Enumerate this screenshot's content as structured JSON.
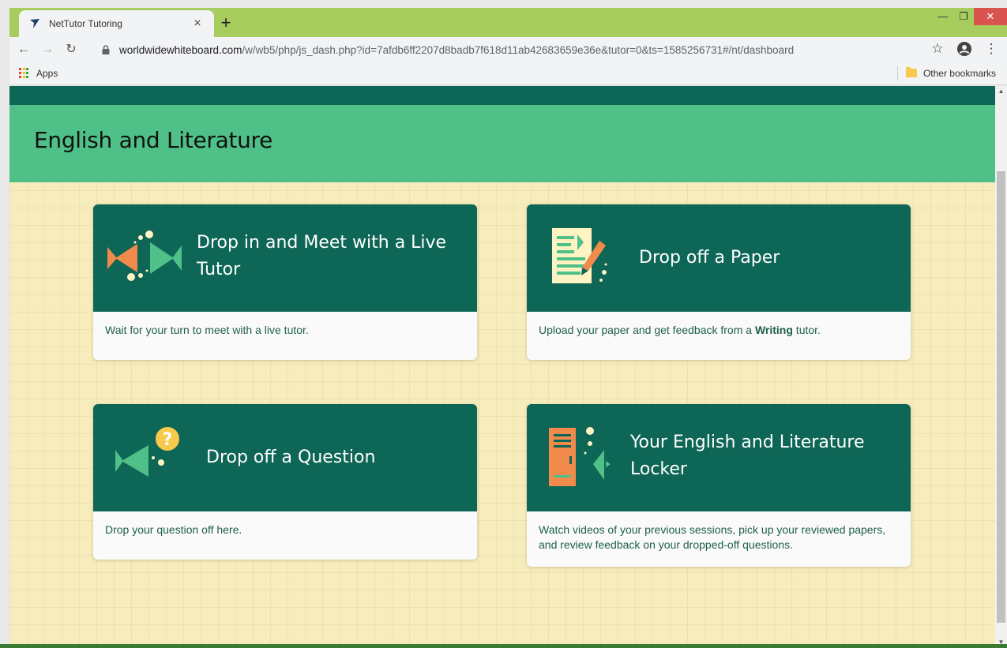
{
  "browser": {
    "tab_title": "NetTutor Tutoring",
    "tab_close": "×",
    "new_tab": "+",
    "url_host": "worldwidewhiteboard.com",
    "url_path": "/w/wb5/php/js_dash.php?id=7afdb6ff2207d8badb7f618d11ab42683659e36e&tutor=0&ts=1585256731#/nt/dashboard",
    "bookmarks_apps": "Apps",
    "bookmarks_other": "Other bookmarks",
    "titlebar_color": "#a6cd5e"
  },
  "page": {
    "title": "English and Literature",
    "colors": {
      "dark_green": "#0e6656",
      "band_green": "#4ec088",
      "background": "#f7ecbb",
      "orange": "#f28a4b"
    }
  },
  "cards": [
    {
      "title_line1": "Drop in and Meet with a Live",
      "title_line2": "Tutor",
      "description": "Wait for your turn to meet with a live tutor.",
      "icon": "fish-meeting-icon"
    },
    {
      "title_line1": "Drop off a Paper",
      "description_before": "Upload your paper and get feedback from a ",
      "description_bold": "Writing",
      "description_after": " tutor.",
      "icon": "paper-pencil-icon"
    },
    {
      "title_line1": "Drop off a Question",
      "description": "Drop your question off here.",
      "icon": "fish-question-icon"
    },
    {
      "title_line1": "Your English and Literature",
      "title_line2": "Locker",
      "description": "Watch videos of your previous sessions, pick up your reviewed papers, and review feedback on your dropped-off questions.",
      "icon": "locker-icon"
    }
  ]
}
